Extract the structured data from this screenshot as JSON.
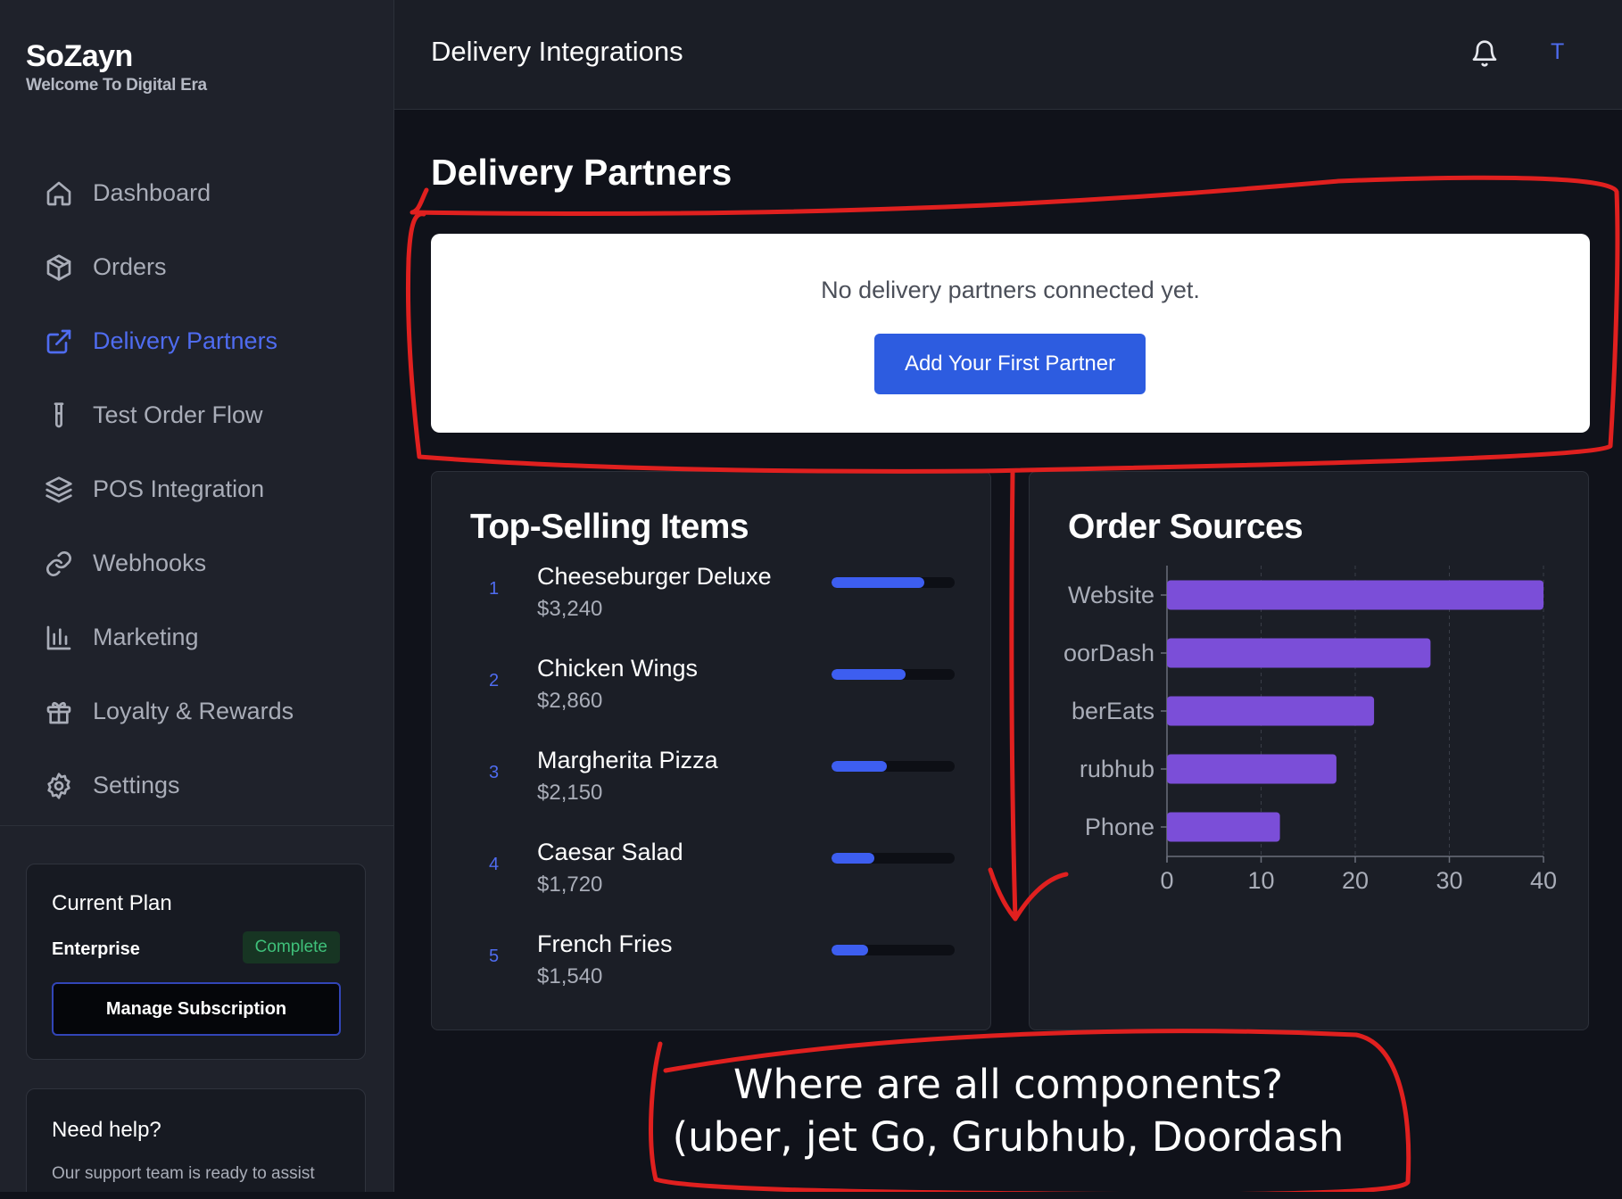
{
  "brand": {
    "name": "SoZayn",
    "tagline": "Welcome To Digital Era"
  },
  "sidebar": {
    "items": [
      {
        "label": "Dashboard",
        "icon": "home-icon",
        "active": false
      },
      {
        "label": "Orders",
        "icon": "package-icon",
        "active": false
      },
      {
        "label": "Delivery Partners",
        "icon": "external-link-icon",
        "active": true
      },
      {
        "label": "Test Order Flow",
        "icon": "test-tube-icon",
        "active": false
      },
      {
        "label": "POS Integration",
        "icon": "layers-icon",
        "active": false
      },
      {
        "label": "Webhooks",
        "icon": "link-icon",
        "active": false
      },
      {
        "label": "Marketing",
        "icon": "bar-chart-icon",
        "active": false
      },
      {
        "label": "Loyalty & Rewards",
        "icon": "gift-icon",
        "active": false
      },
      {
        "label": "Settings",
        "icon": "gear-icon",
        "active": false
      }
    ],
    "plan": {
      "title": "Current Plan",
      "name": "Enterprise",
      "status": "Complete",
      "button": "Manage Subscription"
    },
    "help": {
      "title": "Need help?",
      "text": "Our support team is ready to assist you with any questions."
    }
  },
  "header": {
    "title": "Delivery Integrations",
    "avatar_initial": "T"
  },
  "main": {
    "section_title": "Delivery Partners",
    "empty_message": "No delivery partners connected yet.",
    "add_button": "Add Your First Partner",
    "top_selling": {
      "title": "Top-Selling Items",
      "items": [
        {
          "rank": "1",
          "name": "Cheeseburger Deluxe",
          "price": "$3,240",
          "share": 0.75
        },
        {
          "rank": "2",
          "name": "Chicken Wings",
          "price": "$2,860",
          "share": 0.6
        },
        {
          "rank": "3",
          "name": "Margherita Pizza",
          "price": "$2,150",
          "share": 0.45
        },
        {
          "rank": "4",
          "name": "Caesar Salad",
          "price": "$1,720",
          "share": 0.35
        },
        {
          "rank": "5",
          "name": "French Fries",
          "price": "$1,540",
          "share": 0.3
        }
      ]
    },
    "order_sources": {
      "title": "Order Sources"
    }
  },
  "chart_data": {
    "type": "bar",
    "orientation": "horizontal",
    "title": "Order Sources",
    "categories": [
      "Website",
      "DoorDash",
      "UberEats",
      "Grubhub",
      "Phone"
    ],
    "category_labels_visible": [
      "Website",
      "oorDash",
      "berEats",
      "rubhub",
      "Phone"
    ],
    "values": [
      40,
      28,
      22,
      18,
      12
    ],
    "xlim": [
      0,
      40
    ],
    "xticks": [
      0,
      10,
      20,
      30,
      40
    ],
    "grid": "vertical dashed",
    "color": "#7b4ed8"
  },
  "annotation": {
    "lines": [
      "Where are all components?",
      "(uber, jet Go, Grubhub, Doordash"
    ],
    "color": "#e0201f"
  }
}
